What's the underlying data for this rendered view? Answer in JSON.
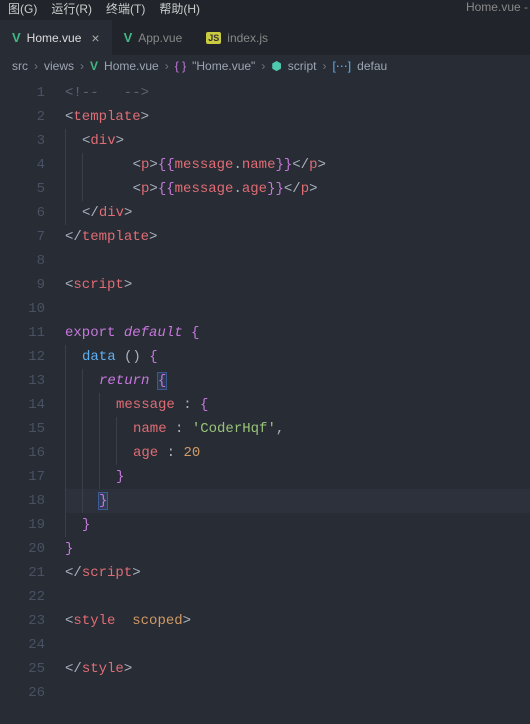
{
  "menubar": {
    "items": [
      "图(G)",
      "运行(R)",
      "终端(T)",
      "帮助(H)"
    ],
    "title": "Home.vue -"
  },
  "tabs": [
    {
      "icon": "vue",
      "label": "Home.vue",
      "active": true,
      "closable": true
    },
    {
      "icon": "vue",
      "label": "App.vue",
      "active": false,
      "closable": false
    },
    {
      "icon": "js",
      "label": "index.js",
      "active": false,
      "closable": false
    }
  ],
  "breadcrumbs": {
    "parts": [
      {
        "icon": null,
        "text": "src"
      },
      {
        "icon": null,
        "text": "views"
      },
      {
        "icon": "vue",
        "text": "Home.vue"
      },
      {
        "icon": "braces",
        "text": "\"Home.vue\""
      },
      {
        "icon": "cube",
        "text": "script"
      },
      {
        "icon": "brackets",
        "text": "defau"
      }
    ]
  },
  "editor": {
    "highlighted_line": 18,
    "lines": [
      {
        "n": 1,
        "tokens": [
          [
            "c-comment",
            "<!--   -->"
          ]
        ]
      },
      {
        "n": 2,
        "tokens": [
          [
            "c-delim",
            "<"
          ],
          [
            "c-tag",
            "template"
          ],
          [
            "c-delim",
            ">"
          ]
        ]
      },
      {
        "n": 3,
        "indent": 1,
        "tokens": [
          [
            "c-delim",
            "<"
          ],
          [
            "c-tag",
            "div"
          ],
          [
            "c-delim",
            ">"
          ]
        ]
      },
      {
        "n": 4,
        "indent": 2,
        "text_plain": "    <p>{{message.name}}</p>",
        "tokens": [
          [
            "c-delim",
            "    <"
          ],
          [
            "c-tag",
            "p"
          ],
          [
            "c-delim",
            ">"
          ],
          [
            "c-brace",
            "{{"
          ],
          [
            "c-ident",
            "message"
          ],
          [
            "c-delim",
            "."
          ],
          [
            "c-ident",
            "name"
          ],
          [
            "c-brace",
            "}}"
          ],
          [
            "c-delim",
            "</"
          ],
          [
            "c-tag",
            "p"
          ],
          [
            "c-delim",
            ">"
          ]
        ]
      },
      {
        "n": 5,
        "indent": 2,
        "text_plain": "    <p>{{message.age}}</p>",
        "tokens": [
          [
            "c-delim",
            "    <"
          ],
          [
            "c-tag",
            "p"
          ],
          [
            "c-delim",
            ">"
          ],
          [
            "c-brace",
            "{{"
          ],
          [
            "c-ident",
            "message"
          ],
          [
            "c-delim",
            "."
          ],
          [
            "c-ident",
            "age"
          ],
          [
            "c-brace",
            "}}"
          ],
          [
            "c-delim",
            "</"
          ],
          [
            "c-tag",
            "p"
          ],
          [
            "c-delim",
            ">"
          ]
        ]
      },
      {
        "n": 6,
        "indent": 1,
        "tokens": [
          [
            "c-delim",
            "</"
          ],
          [
            "c-tag",
            "div"
          ],
          [
            "c-delim",
            ">"
          ]
        ]
      },
      {
        "n": 7,
        "tokens": [
          [
            "c-delim",
            "</"
          ],
          [
            "c-tag",
            "template"
          ],
          [
            "c-delim",
            ">"
          ]
        ]
      },
      {
        "n": 8,
        "tokens": []
      },
      {
        "n": 9,
        "tokens": [
          [
            "c-delim",
            "<"
          ],
          [
            "c-tag",
            "script"
          ],
          [
            "c-delim",
            ">"
          ]
        ]
      },
      {
        "n": 10,
        "tokens": []
      },
      {
        "n": 11,
        "tokens": [
          [
            "c-kw",
            "export"
          ],
          [
            "c-delim",
            " "
          ],
          [
            "c-kw2",
            "default"
          ],
          [
            "c-delim",
            " "
          ],
          [
            "c-brace",
            "{"
          ]
        ]
      },
      {
        "n": 12,
        "indent": 1,
        "tokens": [
          [
            "c-fn",
            "data"
          ],
          [
            "c-delim",
            " () "
          ],
          [
            "c-brace",
            "{"
          ]
        ]
      },
      {
        "n": 13,
        "indent": 2,
        "tokens": [
          [
            "c-kw2",
            "return"
          ],
          [
            "c-delim",
            " "
          ],
          [
            "c-brace c-cur",
            "{"
          ]
        ]
      },
      {
        "n": 14,
        "indent": 3,
        "tokens": [
          [
            "c-ident",
            "message"
          ],
          [
            "c-delim",
            " : "
          ],
          [
            "c-brace",
            "{"
          ]
        ]
      },
      {
        "n": 15,
        "indent": 4,
        "tokens": [
          [
            "c-ident",
            "name"
          ],
          [
            "c-delim",
            " : "
          ],
          [
            "c-str",
            "'CoderHqf'"
          ],
          [
            "c-delim",
            ","
          ]
        ]
      },
      {
        "n": 16,
        "indent": 4,
        "tokens": [
          [
            "c-ident",
            "age"
          ],
          [
            "c-delim",
            " : "
          ],
          [
            "c-num",
            "20"
          ]
        ]
      },
      {
        "n": 17,
        "indent": 3,
        "tokens": [
          [
            "c-brace",
            "}"
          ]
        ]
      },
      {
        "n": 18,
        "indent": 2,
        "tokens": [
          [
            "c-brace c-cur",
            "}"
          ]
        ]
      },
      {
        "n": 19,
        "indent": 1,
        "tokens": [
          [
            "c-brace",
            "}"
          ]
        ]
      },
      {
        "n": 20,
        "tokens": [
          [
            "c-brace",
            "}"
          ]
        ]
      },
      {
        "n": 21,
        "tokens": [
          [
            "c-delim",
            "</"
          ],
          [
            "c-tag",
            "script"
          ],
          [
            "c-delim",
            ">"
          ]
        ]
      },
      {
        "n": 22,
        "tokens": []
      },
      {
        "n": 23,
        "tokens": [
          [
            "c-delim",
            "<"
          ],
          [
            "c-tag",
            "style"
          ],
          [
            "c-delim",
            "  "
          ],
          [
            "c-attr",
            "scoped"
          ],
          [
            "c-delim",
            ">"
          ]
        ]
      },
      {
        "n": 24,
        "tokens": []
      },
      {
        "n": 25,
        "tokens": [
          [
            "c-delim",
            "</"
          ],
          [
            "c-tag",
            "style"
          ],
          [
            "c-delim",
            ">"
          ]
        ]
      },
      {
        "n": 26,
        "tokens": []
      }
    ]
  }
}
